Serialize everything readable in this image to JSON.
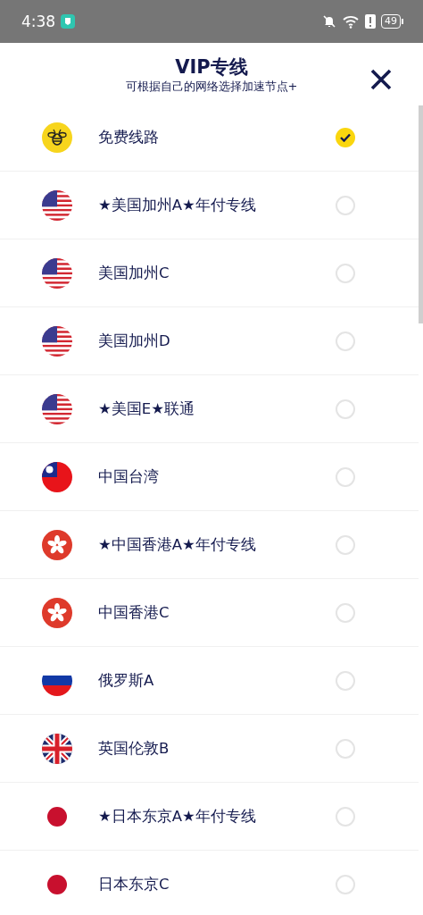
{
  "status_bar": {
    "time": "4:38",
    "battery": "49"
  },
  "header": {
    "title": "VIP专线",
    "subtitle": "可根据自己的网络选择加速节点+"
  },
  "servers": [
    {
      "name": "免费线路",
      "kind": "bee",
      "selected": true
    },
    {
      "name": "★美国加州A★年付专线",
      "kind": "us",
      "selected": false
    },
    {
      "name": "美国加州C",
      "kind": "us",
      "selected": false
    },
    {
      "name": "美国加州D",
      "kind": "us",
      "selected": false
    },
    {
      "name": "★美国E★联通",
      "kind": "us",
      "selected": false
    },
    {
      "name": "中国台湾",
      "kind": "tw",
      "selected": false
    },
    {
      "name": "★中国香港A★年付专线",
      "kind": "hk",
      "selected": false
    },
    {
      "name": "中国香港C",
      "kind": "hk",
      "selected": false
    },
    {
      "name": "俄罗斯A",
      "kind": "ru",
      "selected": false
    },
    {
      "name": "英国伦敦B",
      "kind": "uk",
      "selected": false
    },
    {
      "name": "★日本东京A★年付专线",
      "kind": "jp",
      "selected": false
    },
    {
      "name": "日本东京C",
      "kind": "jp",
      "selected": false
    }
  ]
}
